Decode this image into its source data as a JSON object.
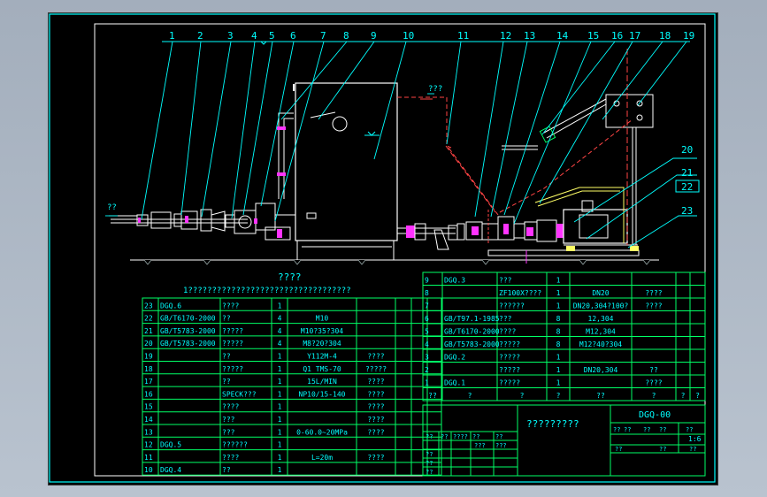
{
  "title_block_text": "?????????",
  "drawing_number": "DGQ-00",
  "scale": "1:6",
  "parts_title": "????",
  "parts_subtitle": "1??????????????????????????????????",
  "callouts_top": [
    "1",
    "2",
    "3",
    "4",
    "5",
    "6",
    "7",
    "8",
    "9",
    "10",
    "11",
    "12",
    "13",
    "14",
    "15",
    "16",
    "17",
    "18",
    "19"
  ],
  "callouts_right": [
    "20",
    "21",
    "22",
    "23"
  ],
  "label_inlet": "??",
  "label_drain": "???",
  "bom_left": [
    {
      "no": "23",
      "code": "DGQ.6",
      "name": "????",
      "qty": "1",
      "spec": "",
      "mat": ""
    },
    {
      "no": "22",
      "code": "GB/T6170-2000",
      "name": "??",
      "qty": "4",
      "spec": "M10",
      "mat": ""
    },
    {
      "no": "21",
      "code": "GB/T5783-2000",
      "name": "?????",
      "qty": "4",
      "spec": "M10?35?304",
      "mat": ""
    },
    {
      "no": "20",
      "code": "GB/T5783-2000",
      "name": "?????",
      "qty": "4",
      "spec": "M8?20?304",
      "mat": ""
    },
    {
      "no": "19",
      "code": "",
      "name": "??",
      "qty": "1",
      "spec": "Y112M-4",
      "mat": "????"
    },
    {
      "no": "18",
      "code": "",
      "name": "?????",
      "qty": "1",
      "spec": "Q1 TMS-70",
      "mat": "?????"
    },
    {
      "no": "17",
      "code": "",
      "name": "??",
      "qty": "1",
      "spec": "15L/MIN",
      "mat": "????"
    },
    {
      "no": "16",
      "code": "",
      "name": "SPECK???",
      "qty": "1",
      "spec": "NP10/15-140",
      "mat": "????"
    },
    {
      "no": "15",
      "code": "",
      "name": "????",
      "qty": "1",
      "spec": "",
      "mat": "????"
    },
    {
      "no": "14",
      "code": "",
      "name": "???",
      "qty": "1",
      "spec": "",
      "mat": "????"
    },
    {
      "no": "13",
      "code": "",
      "name": "???",
      "qty": "1",
      "spec": "0-60.0~20MPa",
      "mat": "????"
    },
    {
      "no": "12",
      "code": "DGQ.5",
      "name": "??????",
      "qty": "1",
      "spec": "",
      "mat": ""
    },
    {
      "no": "11",
      "code": "",
      "name": "????",
      "qty": "1",
      "spec": "L=20m",
      "mat": "????"
    },
    {
      "no": "10",
      "code": "DGQ.4",
      "name": "??",
      "qty": "1",
      "spec": "",
      "mat": ""
    }
  ],
  "bom_right": [
    {
      "no": "9",
      "code": "DGQ.3",
      "name": "???",
      "qty": "1",
      "spec": "",
      "mat": ""
    },
    {
      "no": "8",
      "code": "",
      "name": "ZF100X????",
      "qty": "1",
      "spec": "DN20",
      "mat": "????"
    },
    {
      "no": "7",
      "code": "",
      "name": "??????",
      "qty": "1",
      "spec": "DN20,304?100?",
      "mat": "????"
    },
    {
      "no": "6",
      "code": "GB/T97.1-1985",
      "name": "???",
      "qty": "8",
      "spec": "12,304",
      "mat": ""
    },
    {
      "no": "5",
      "code": "GB/T6170-2000",
      "name": "????",
      "qty": "8",
      "spec": "M12,304",
      "mat": ""
    },
    {
      "no": "4",
      "code": "GB/T5783-2000",
      "name": "?????",
      "qty": "8",
      "spec": "M12?40?304",
      "mat": ""
    },
    {
      "no": "3",
      "code": "DGQ.2",
      "name": "?????",
      "qty": "1",
      "spec": "",
      "mat": ""
    },
    {
      "no": "2",
      "code": "",
      "name": "?????",
      "qty": "1",
      "spec": "DN20,304",
      "mat": "??"
    },
    {
      "no": "1",
      "code": "DGQ.1",
      "name": "?????",
      "qty": "1",
      "spec": "",
      "mat": "????"
    }
  ],
  "bom_header": [
    "??",
    "?",
    "?",
    "?",
    "??",
    "?",
    "?",
    "?"
  ],
  "tb_small": [
    "??",
    "??",
    "????",
    "??",
    "??",
    "???",
    "???",
    "??",
    "??",
    "??",
    "??",
    "??",
    "??",
    "??",
    "??",
    "??",
    "??",
    "??"
  ]
}
